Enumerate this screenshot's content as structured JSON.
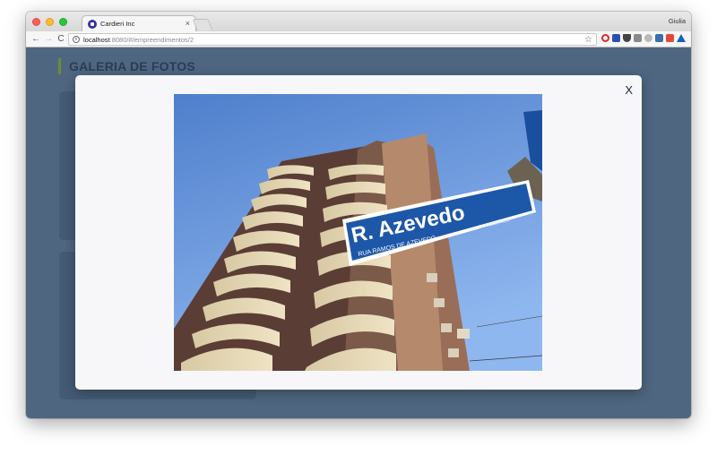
{
  "browser": {
    "tab_title": "Cardieri Inc",
    "tab_close": "×",
    "user_name": "Giulia",
    "url_host": "localhost",
    "url_rest": ":8080/#/empreendimentos/2",
    "info_glyph": "i",
    "star_glyph": "☆",
    "menu_glyph": "⋮",
    "nav": {
      "back": "←",
      "forward": "→",
      "reload": "C"
    },
    "extensions": [
      "opera-icon",
      "info-extension-icon",
      "pocket-icon",
      "grid-extension-icon",
      "cloud-extension-icon",
      "people-extension-icon",
      "store-extension-icon",
      "drive-icon"
    ]
  },
  "page": {
    "section_title": "GALERIA DE FOTOS",
    "thumbnails": 2
  },
  "modal": {
    "close_label": "X",
    "photo": {
      "sign_title": "R. Azevedo",
      "sign_subtitle": "RUA RAMOS DE AZEVEDO",
      "sign_note": "CEP 01007-000"
    }
  },
  "colors": {
    "page_background": "#4f6681",
    "modal_background": "#f7f7f9",
    "title_color": "#2c3c52",
    "close_color": "#1b2a48",
    "sign_blue": "#1d57a8",
    "sky": "#6a9ad7"
  }
}
